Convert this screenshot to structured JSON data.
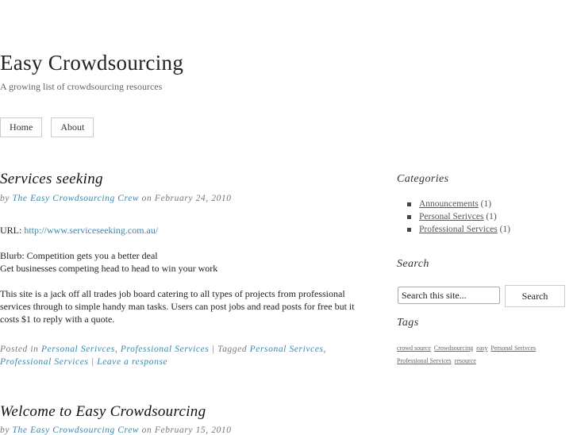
{
  "site": {
    "title": "Easy Crowdsourcing",
    "description": "A growing list of crowdsourcing resources"
  },
  "nav": [
    {
      "label": "Home"
    },
    {
      "label": "About"
    }
  ],
  "posts": [
    {
      "title": "Services seeking",
      "by": "by",
      "author": "The Easy Crowdsourcing Crew",
      "on": "on",
      "date": "February 24, 2010",
      "url_label": "URL:",
      "url": "http://www.serviceseeking.com.au/",
      "blurb1": "Blurb: Competition gets you a better deal",
      "blurb2": "Get businesses competing head to head to win your work",
      "body": "This site is a jack off all trades job board catering to all types of projects from professional services through to simple handy man tasks. Users can post jobs and read posts for free but it costs $1 to reply with a quote.",
      "posted_in": "Posted in",
      "categories": [
        "Personal Serivces",
        "Professional Services"
      ],
      "tagged": "Tagged",
      "tags": [
        "Personal Serivces",
        "Professional Services"
      ],
      "response": "Leave a response"
    },
    {
      "title": "Welcome to Easy Crowdsourcing",
      "by": "by",
      "author": "The Easy Crowdsourcing Crew",
      "on": "on",
      "date": "February 15, 2010"
    }
  ],
  "sidebar": {
    "categories_title": "Categories",
    "categories": [
      {
        "label": "Announcements",
        "count": "(1)"
      },
      {
        "label": "Personal Serivces",
        "count": "(1)"
      },
      {
        "label": "Professional Services",
        "count": "(1)"
      }
    ],
    "search_title": "Search",
    "search_value": "Search this site...",
    "search_button": "Search",
    "tags_title": "Tags",
    "tags": [
      "crowd source",
      "Crowdsourcing",
      "easy",
      "Personal Serivces",
      "Professional Services",
      "resource"
    ]
  },
  "colors": {
    "link": "#3a86aa",
    "text": "#222222",
    "meta": "#777777"
  }
}
